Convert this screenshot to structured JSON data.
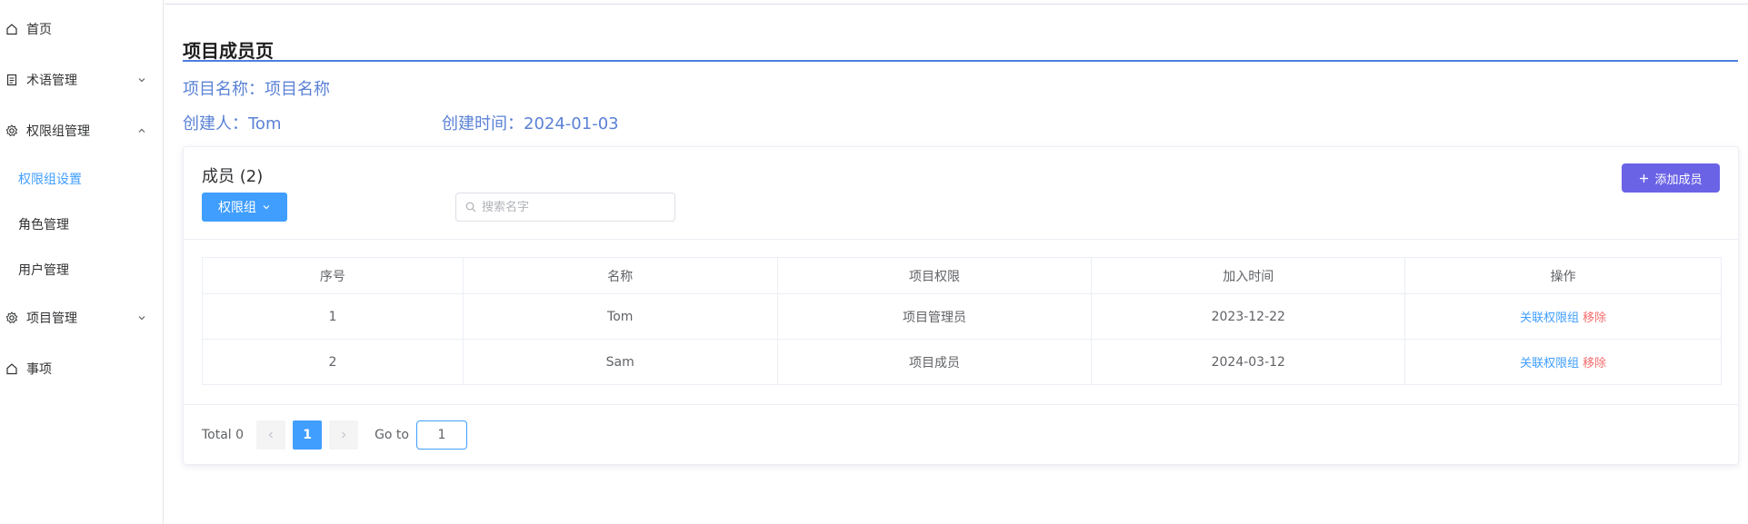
{
  "sidebar": {
    "items": [
      {
        "label": "首页",
        "icon": "home-icon"
      },
      {
        "label": "术语管理",
        "icon": "document-icon"
      },
      {
        "label": "权限组管理",
        "icon": "gear-icon"
      },
      {
        "label": "权限组设置",
        "active": true
      },
      {
        "label": "角色管理"
      },
      {
        "label": "用户管理"
      },
      {
        "label": "项目管理",
        "icon": "gear-icon"
      },
      {
        "label": "事项",
        "icon": "home-icon"
      }
    ]
  },
  "page": {
    "title": "项目成员页",
    "project_name": "项目名称：项目名称",
    "creator": "创建人：Tom",
    "created_time": "创建时间：2024-01-03"
  },
  "card": {
    "members_title": "成员 (2)",
    "perm_button": "权限组",
    "search_placeholder": "搜索名字",
    "add_button": "添加成员"
  },
  "table": {
    "headers": [
      "序号",
      "名称",
      "项目权限",
      "加入时间",
      "操作"
    ],
    "rows": [
      {
        "index": "1",
        "name": "Tom",
        "role": "项目管理员",
        "joined": "2023-12-22"
      },
      {
        "index": "2",
        "name": "Sam",
        "role": "项目成员",
        "joined": "2024-03-12"
      }
    ],
    "action_assoc": "关联权限组",
    "action_remove": "移除"
  },
  "pagination": {
    "total": "Total 0",
    "current_page": "1",
    "goto_label": "Go to",
    "goto_value": "1"
  },
  "colors": {
    "primary": "#409eff",
    "accent_purple": "#6b63e6",
    "danger": "#f56c6c",
    "info_text": "#5b82d6"
  }
}
